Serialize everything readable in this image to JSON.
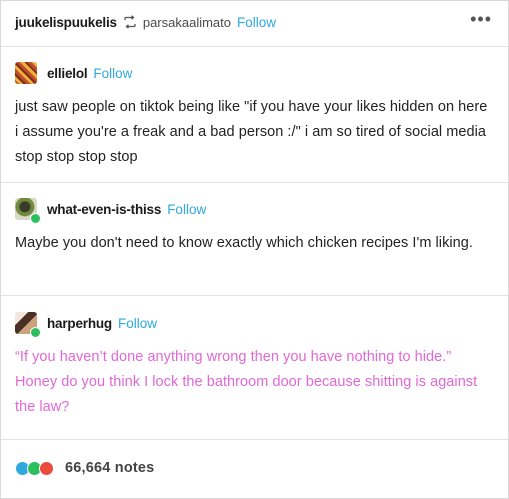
{
  "post": {
    "reblogger": "juukelispuukelis",
    "source": "parsakaalimato",
    "follow_label": "Follow",
    "more_label": "•••"
  },
  "reblogs": [
    {
      "username": "ellielol",
      "follow_label": "Follow",
      "text": "just saw people on tiktok being like \"if you have your likes hidden on here i assume you're a freak and a bad person :/\" i am so tired of social media stop stop stop stop"
    },
    {
      "username": "what-even-is-thiss",
      "follow_label": "Follow",
      "text": "Maybe you don't need to know exactly which chicken recipes I'm liking."
    },
    {
      "username": "harperhug",
      "follow_label": "Follow",
      "text": "“If you haven’t done anything wrong then you have nothing to hide.” Honey do you think I lock the bathroom door because shitting is against the law?"
    }
  ],
  "notes": {
    "count_label": "66,664 notes"
  },
  "colors": {
    "link_blue": "#2fa8de",
    "quote_pink": "#e168d6",
    "badge_green": "#2cbf5f"
  }
}
